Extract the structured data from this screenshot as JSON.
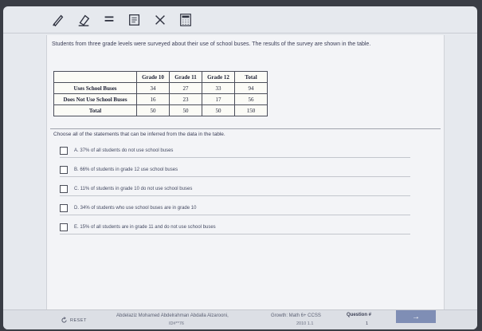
{
  "toolbar": {
    "tools": [
      "pencil-icon",
      "eraser-icon",
      "line-reader-icon",
      "notepad-icon",
      "eliminate-choice-icon",
      "calculator-icon"
    ]
  },
  "question": {
    "text": "Students from three grade levels were surveyed about their use of school buses. The results of the survey are shown in the table."
  },
  "table": {
    "headers": [
      "",
      "Grade 10",
      "Grade 11",
      "Grade 12",
      "Total"
    ],
    "rows": [
      {
        "label": "Uses School Buses",
        "values": [
          "34",
          "27",
          "33",
          "94"
        ]
      },
      {
        "label": "Does Not Use School Buses",
        "values": [
          "16",
          "23",
          "17",
          "56"
        ]
      },
      {
        "label": "Total",
        "values": [
          "50",
          "50",
          "50",
          "150"
        ]
      }
    ]
  },
  "prompt": "Choose all of the statements that can be inferred from the data in the table.",
  "choices": [
    {
      "text": "A. 37% of all students do not use school buses"
    },
    {
      "text": "B. 66% of students in grade 12 use school buses"
    },
    {
      "text": "C. 11% of students in grade 10 do not use school buses"
    },
    {
      "text": "D. 34% of students who use school buses are in grade 10"
    },
    {
      "text": "E. 15% of all students are in grade 11 and do not use school buses"
    }
  ],
  "footer": {
    "reset_label": "RESET",
    "author": "Abdelaziz Mohamed Abdelrahman Abdalla Alzarooni,",
    "item_id": "ID#**76",
    "standard": "Growth: Math 6+ CCSS",
    "standard_code": "2010 1.1",
    "question_label": "Question #",
    "question_number": "1",
    "next_label": "→"
  },
  "colors": {
    "next_button": "#7f8eb5",
    "panel_background": "#f3f4f7"
  }
}
